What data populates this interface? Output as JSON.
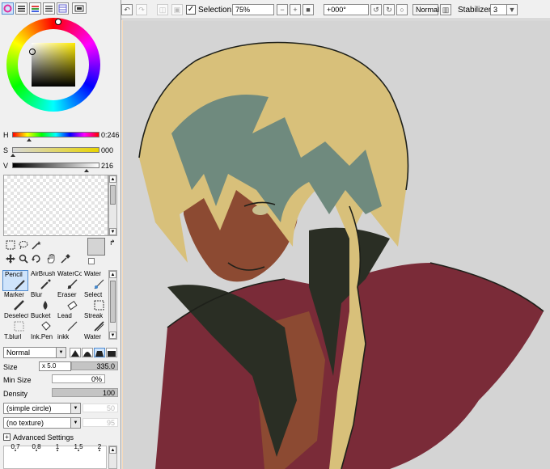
{
  "colors": {
    "accent": "#4f8bd0",
    "panel": "#f0f0f0",
    "canvas_bg": "#d4d4d4",
    "hair": "#d8c07a",
    "hair_shadow": "#6f8a7e",
    "skin": "#8c4a32",
    "coat": "#7a2b38",
    "collar": "#2a2e24"
  },
  "panel_tabs": [
    "color-wheel-icon",
    "rgb-sliders-icon",
    "hsv-sliders-icon",
    "swatches-icon",
    "scratchpad-icon",
    "panel-menu-icon"
  ],
  "hsv": {
    "h_label": "H",
    "h_value": "0:246",
    "s_label": "S",
    "s_value": "000",
    "v_label": "V",
    "v_value": "216"
  },
  "brushes": [
    {
      "name": "Pencil",
      "icon": "pencil-icon",
      "selected": true
    },
    {
      "name": "AirBrush",
      "icon": "airbrush-icon"
    },
    {
      "name": "WaterCo",
      "icon": "watercolor-icon"
    },
    {
      "name": "Water",
      "icon": "water-icon"
    },
    {
      "name": "Marker",
      "icon": "marker-icon"
    },
    {
      "name": "Blur",
      "icon": "blur-icon"
    },
    {
      "name": "Eraser",
      "icon": "eraser-icon"
    },
    {
      "name": "Select",
      "icon": "select-icon"
    },
    {
      "name": "Deselect",
      "icon": "deselect-icon"
    },
    {
      "name": "Bucket",
      "icon": "bucket-icon"
    },
    {
      "name": "Lead",
      "icon": "lead-icon"
    },
    {
      "name": "Streak",
      "icon": "streak-icon"
    },
    {
      "name": "T.blurl",
      "icon": ""
    },
    {
      "name": "Ink.Pen",
      "icon": ""
    },
    {
      "name": "inkk",
      "icon": ""
    },
    {
      "name": "Water",
      "icon": ""
    }
  ],
  "brush_settings": {
    "blend_mode": "Normal",
    "size_label": "Size",
    "size_multiplier": "x 5.0",
    "size_value": "335.0",
    "min_size_label": "Min Size",
    "min_size_value": "0%",
    "density_label": "Density",
    "density_value": "100",
    "shape": "(simple circle)",
    "shape_value": "50",
    "texture": "(no texture)",
    "texture_value": "95",
    "advanced_label": "Advanced Settings",
    "sizes": [
      "0.7",
      "0.8",
      "1",
      "1.5",
      "2"
    ]
  },
  "toolbar": {
    "selection_label": "Selection",
    "selection_checked": true,
    "zoom": "75%",
    "rotation": "+000°",
    "blend": "Normal",
    "stabilizer_label": "Stabilizer",
    "stabilizer_value": "3"
  }
}
